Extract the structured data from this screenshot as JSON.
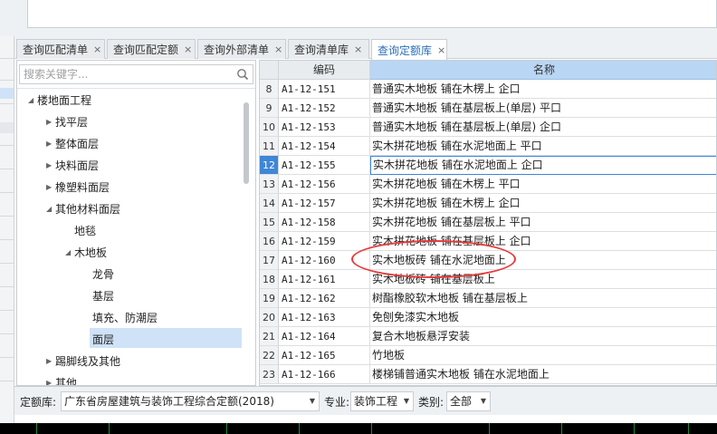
{
  "tabs": [
    {
      "label": "查询匹配清单",
      "close": "×"
    },
    {
      "label": "查询匹配定额",
      "close": "×"
    },
    {
      "label": "查询外部清单",
      "close": "×"
    },
    {
      "label": "查询清单库",
      "close": "×"
    },
    {
      "label": "查询定额库",
      "close": "×",
      "active": true
    }
  ],
  "search": {
    "placeholder": "搜索关键字..."
  },
  "tree": [
    {
      "label": "楼地面工程",
      "level": 0,
      "expanded": true
    },
    {
      "label": "找平层",
      "level": 1,
      "expanded": false
    },
    {
      "label": "整体面层",
      "level": 1,
      "expanded": false
    },
    {
      "label": "块料面层",
      "level": 1,
      "expanded": false
    },
    {
      "label": "橡塑料面层",
      "level": 1,
      "expanded": false
    },
    {
      "label": "其他材料面层",
      "level": 1,
      "expanded": true
    },
    {
      "label": "地毯",
      "level": 2
    },
    {
      "label": "木地板",
      "level": 2,
      "expanded": true
    },
    {
      "label": "龙骨",
      "level": 3
    },
    {
      "label": "基层",
      "level": 3
    },
    {
      "label": "填充、防潮层",
      "level": 3
    },
    {
      "label": "面层",
      "level": 3,
      "selected": true
    },
    {
      "label": "踢脚线及其他",
      "level": 1,
      "expanded": false
    },
    {
      "label": "其他",
      "level": 1,
      "expanded": false
    }
  ],
  "grid": {
    "headers": {
      "code": "编码",
      "name": "名称"
    },
    "rows": [
      {
        "num": "8",
        "code": "A1-12-151",
        "name": "普通实木地板 铺在木楞上 企口"
      },
      {
        "num": "9",
        "code": "A1-12-152",
        "name": "普通实木地板 铺在基层板上(单层) 平口"
      },
      {
        "num": "10",
        "code": "A1-12-153",
        "name": "普通实木地板 铺在基层板上(单层) 企口"
      },
      {
        "num": "11",
        "code": "A1-12-154",
        "name": "实木拼花地板 铺在水泥地面上 平口"
      },
      {
        "num": "12",
        "code": "A1-12-155",
        "name": "实木拼花地板 铺在水泥地面上 企口",
        "selected": true
      },
      {
        "num": "13",
        "code": "A1-12-156",
        "name": "实木拼花地板 铺在木楞上 平口"
      },
      {
        "num": "14",
        "code": "A1-12-157",
        "name": "实木拼花地板 铺在木楞上 企口"
      },
      {
        "num": "15",
        "code": "A1-12-158",
        "name": "实木拼花地板 铺在基层板上 平口"
      },
      {
        "num": "16",
        "code": "A1-12-159",
        "name": "实木拼花地板 铺在基层板上 企口"
      },
      {
        "num": "17",
        "code": "A1-12-160",
        "name": "实木地板砖 铺在水泥地面上"
      },
      {
        "num": "18",
        "code": "A1-12-161",
        "name": "实木地板砖 铺在基层板上"
      },
      {
        "num": "19",
        "code": "A1-12-162",
        "name": "树酯橡胶软木地板 铺在基层板上"
      },
      {
        "num": "20",
        "code": "A1-12-163",
        "name": "免刨免漆实木地板"
      },
      {
        "num": "21",
        "code": "A1-12-164",
        "name": "复合木地板悬浮安装"
      },
      {
        "num": "22",
        "code": "A1-12-165",
        "name": "竹地板"
      },
      {
        "num": "23",
        "code": "A1-12-166",
        "name": "楼梯铺普通实木地板 铺在水泥地面上"
      }
    ]
  },
  "filter": {
    "quota_label": "定额库:",
    "quota_value": "广东省房屋建筑与装饰工程综合定额(2018)",
    "major_label": "专业:",
    "major_value": "装饰工程",
    "category_label": "类别:",
    "category_value": "全部"
  },
  "colors": {
    "accent": "#2a6ebb",
    "selection": "#cfe2f7",
    "annotation": "#e53a3a"
  }
}
